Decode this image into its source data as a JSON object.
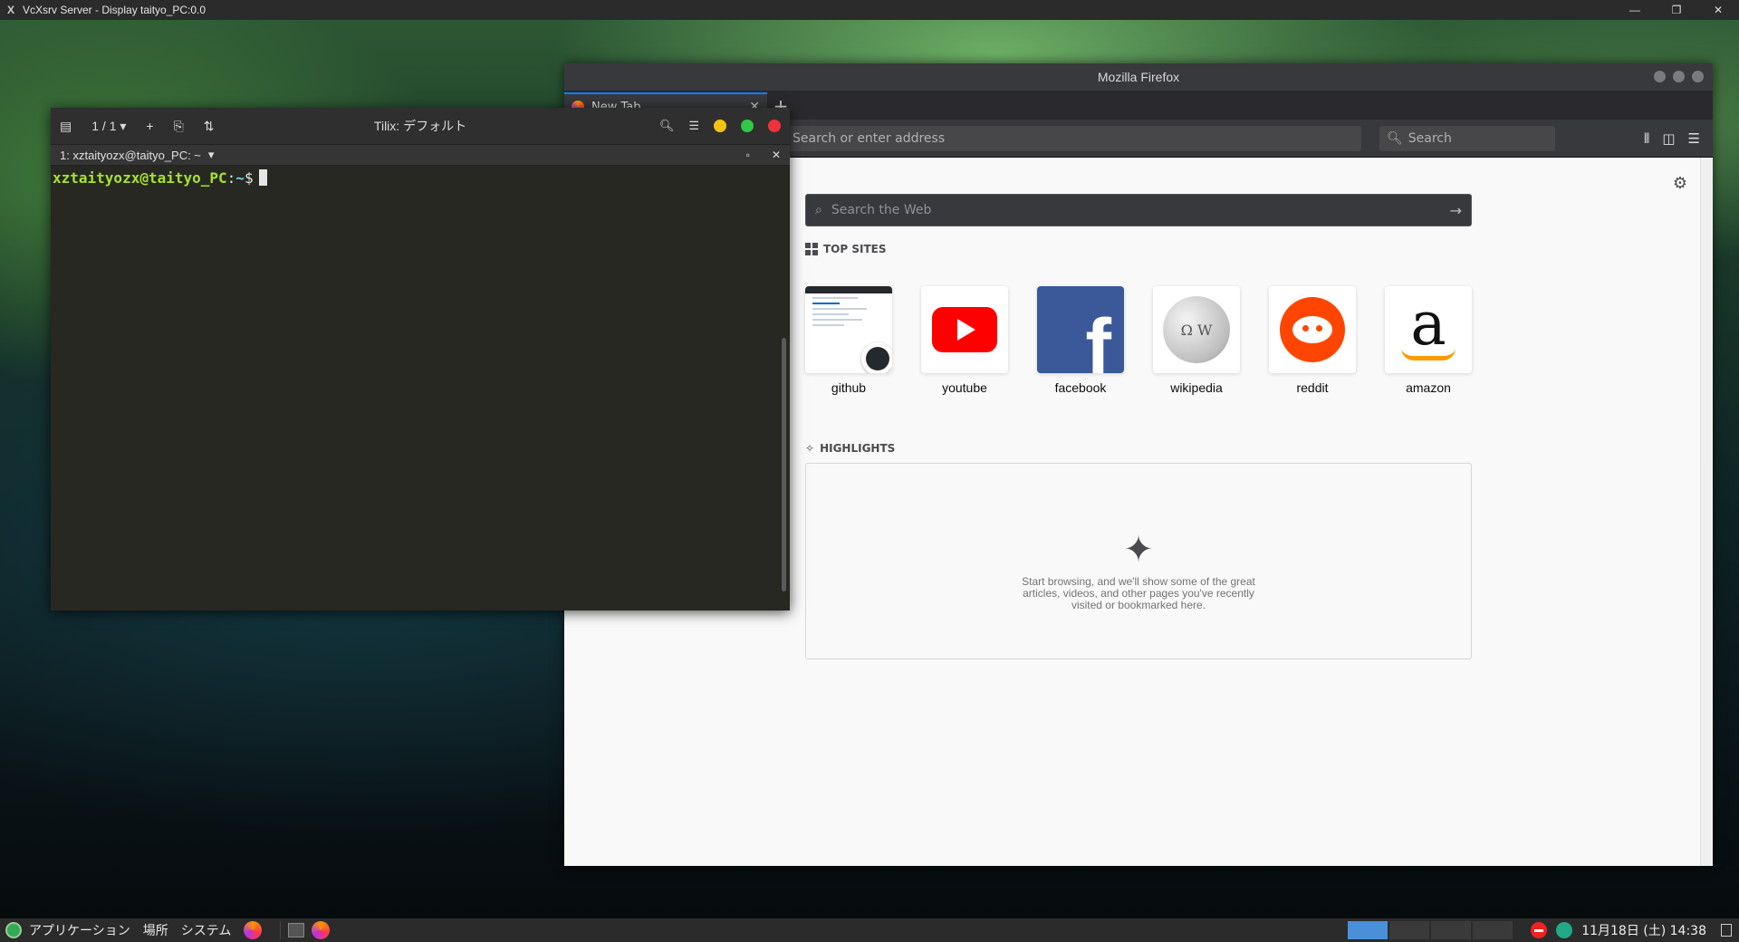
{
  "host": {
    "title": "VcXsrv Server - Display taityo_PC:0.0",
    "minimize": "—",
    "restore": "❐",
    "close": "✕"
  },
  "firefox": {
    "window_title": "Mozilla Firefox",
    "tab_label": "New Tab",
    "tab_close": "✕",
    "new_tab": "+",
    "url_placeholder": "Search or enter address",
    "search_placeholder": "Search",
    "web_search_placeholder": "Search the Web",
    "top_sites_title": "TOP SITES",
    "highlights_title": "HIGHLIGHTS",
    "highlights_message": "Start browsing, and we'll show some of the great articles, videos, and other pages you've recently visited or bookmarked here.",
    "top_sites": [
      {
        "name": "github"
      },
      {
        "name": "youtube"
      },
      {
        "name": "facebook"
      },
      {
        "name": "wikipedia"
      },
      {
        "name": "reddit"
      },
      {
        "name": "amazon"
      }
    ],
    "icons": {
      "library": "library-icon",
      "sidebar": "sidebar-icon",
      "menu": "hamburger-menu-icon",
      "settings": "gear-icon"
    }
  },
  "tilix": {
    "title": "Tilix: デフォルト",
    "session_count": "1 / 1",
    "add": "+",
    "session_label": "1: xztaityozx@taityo_PC: ~",
    "prompt_user": "xztaityozx@taityo_PC",
    "prompt_sep": ":",
    "prompt_path": "~",
    "prompt_symbol": "$"
  },
  "panel": {
    "applications": "アプリケーション",
    "places": "場所",
    "system": "システム",
    "clock": "11月18日 (土) 14:38"
  },
  "colors": {
    "firefox_accent": "#0a84ff",
    "terminal_user": "#a6e22e",
    "terminal_path": "#66d9ef",
    "tilix_minimize": "#f5c211",
    "tilix_maximize": "#33c748",
    "tilix_close": "#ed333b"
  }
}
